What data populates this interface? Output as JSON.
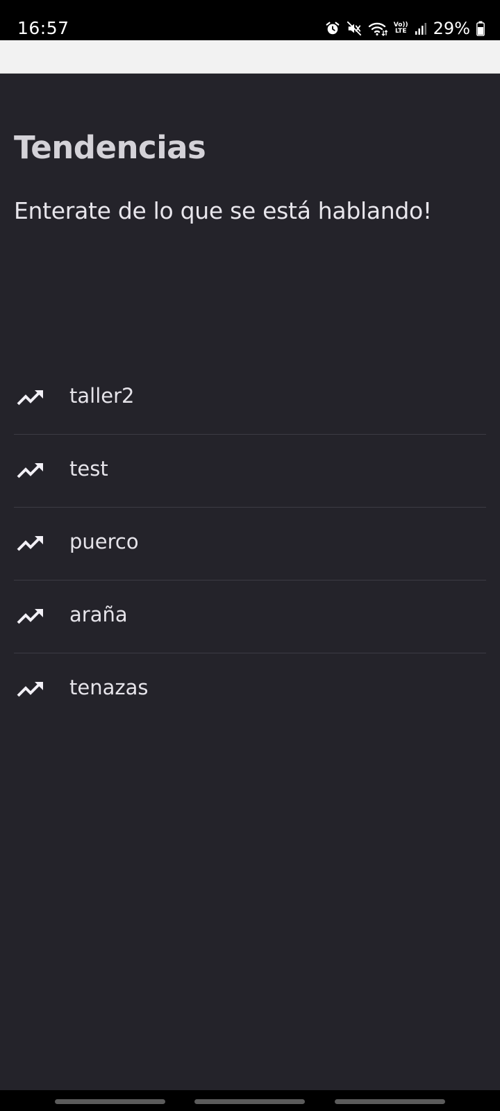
{
  "status_bar": {
    "time": "16:57",
    "icons": [
      "alarm-icon",
      "mute-icon",
      "wifi-icon",
      "volte-icon",
      "signal-icon",
      "battery-icon"
    ],
    "volte_top": "Vo))",
    "volte_bottom": "LTE",
    "battery_percent": "29%"
  },
  "page": {
    "title": "Tendencias",
    "subtitle": "Enterate de lo que se está hablando!"
  },
  "trends": [
    {
      "label": "taller2",
      "icon": "trending-up-icon"
    },
    {
      "label": "test",
      "icon": "trending-up-icon"
    },
    {
      "label": "puerco",
      "icon": "trending-up-icon"
    },
    {
      "label": "araña",
      "icon": "trending-up-icon"
    },
    {
      "label": "tenazas",
      "icon": "trending-up-icon"
    }
  ],
  "colors": {
    "background": "#24232a",
    "title": "#d4d2d8",
    "text": "#e6e4ea",
    "divider": "#3d3c44",
    "app_bar": "#f2f2f2"
  }
}
